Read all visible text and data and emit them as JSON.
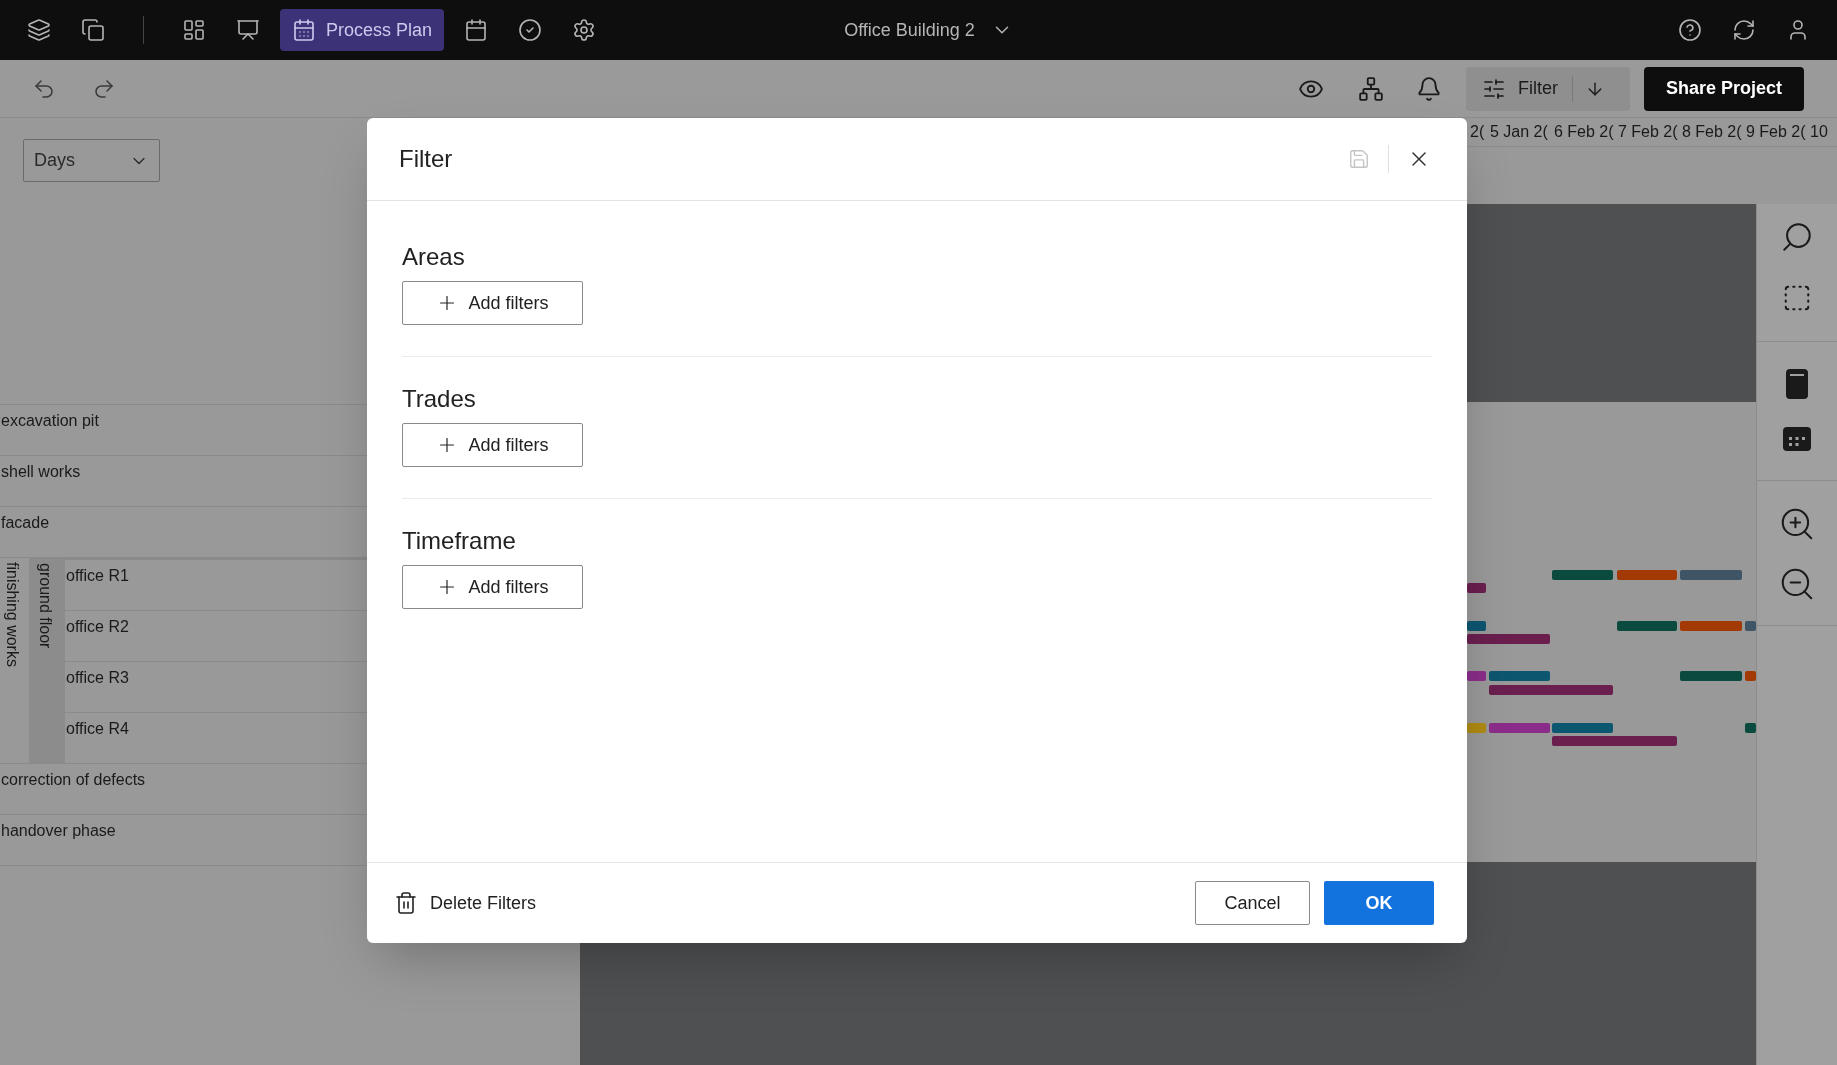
{
  "top_bar": {
    "module_tab": {
      "label": "Process Plan",
      "selected": true
    },
    "project": "Office Building 2"
  },
  "toolbar": {
    "filter_button": {
      "label": "Filter"
    },
    "share_button": {
      "label": "Share Project"
    }
  },
  "timeline": {
    "view_select": {
      "value": "Days"
    },
    "dates": [
      "2(",
      "5 Jan 2(",
      "6 Feb 2(",
      "7 Feb 2(",
      "8 Feb 2(",
      "9 Feb 2(",
      "10"
    ],
    "rows": [
      {
        "label": "excavation pit"
      },
      {
        "label": "shell works"
      },
      {
        "label": "facade"
      },
      {
        "label": "finishing works",
        "children": [
          {
            "label": "ground floor",
            "children": [
              {
                "label": "office R1"
              },
              {
                "label": "office R2"
              },
              {
                "label": "office R3"
              },
              {
                "label": "office R4"
              }
            ]
          }
        ]
      },
      {
        "label": "correction of defects"
      },
      {
        "label": "handover phase"
      }
    ]
  },
  "dialog": {
    "title": "Filter",
    "sections": [
      {
        "title": "Areas",
        "button": "Add filters"
      },
      {
        "title": "Trades",
        "button": "Add filters"
      },
      {
        "title": "Timeframe",
        "button": "Add filters"
      }
    ],
    "delete_button": "Delete Filters",
    "cancel_button": "Cancel",
    "ok_button": "OK"
  }
}
